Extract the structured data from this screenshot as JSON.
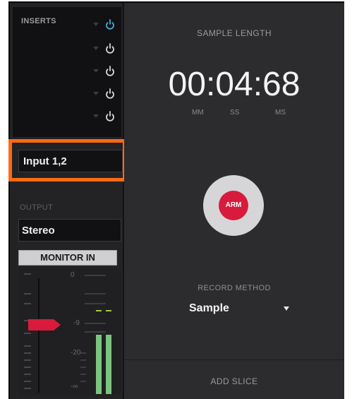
{
  "inserts": {
    "label": "INSERTS",
    "slots": [
      {
        "power": "active"
      },
      {
        "power": "inactive"
      },
      {
        "power": "inactive"
      },
      {
        "power": "inactive"
      },
      {
        "power": "inactive"
      }
    ]
  },
  "input": {
    "value": "Input 1,2"
  },
  "output": {
    "label": "OUTPUT",
    "value": "Stereo"
  },
  "monitor": {
    "label": "MONITOR IN"
  },
  "meter": {
    "scale": [
      "0",
      "-9",
      "-20",
      "-∞"
    ],
    "fader_db": -9,
    "level_left_db": -17,
    "level_right_db": -17,
    "peak_db": -5
  },
  "sample": {
    "title": "SAMPLE LENGTH",
    "time": "00:04:68",
    "units": {
      "mm": "MM",
      "ss": "SS",
      "ms": "MS"
    }
  },
  "arm": {
    "label": "ARM"
  },
  "record": {
    "label": "RECORD METHOD",
    "value": "Sample"
  },
  "add_slice": {
    "label": "ADD SLICE"
  },
  "colors": {
    "highlight": "#ff6a13",
    "arm": "#d81b3c",
    "power_active": "#4aa8d8",
    "meter": "#7bc47f",
    "peak": "#9ccc3d",
    "fader_handle": "#d81b3c"
  },
  "icons": [
    "power-icon",
    "chevron-down-icon"
  ]
}
